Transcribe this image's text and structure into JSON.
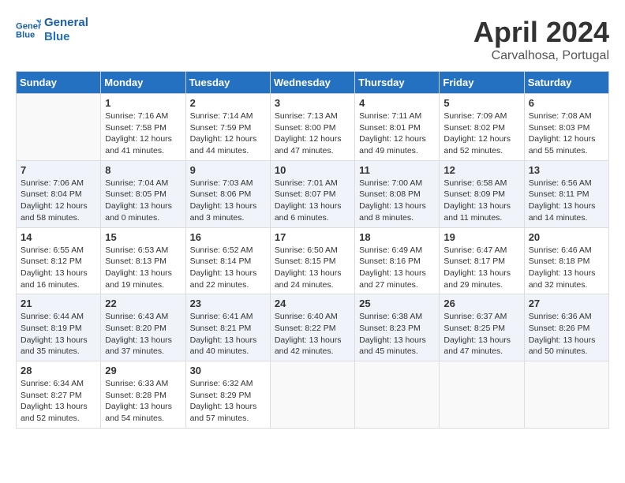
{
  "header": {
    "logo_line1": "General",
    "logo_line2": "Blue",
    "title": "April 2024",
    "subtitle": "Carvalhosa, Portugal"
  },
  "calendar": {
    "days_of_week": [
      "Sunday",
      "Monday",
      "Tuesday",
      "Wednesday",
      "Thursday",
      "Friday",
      "Saturday"
    ],
    "weeks": [
      [
        {
          "day": "",
          "info": ""
        },
        {
          "day": "1",
          "info": "Sunrise: 7:16 AM\nSunset: 7:58 PM\nDaylight: 12 hours\nand 41 minutes."
        },
        {
          "day": "2",
          "info": "Sunrise: 7:14 AM\nSunset: 7:59 PM\nDaylight: 12 hours\nand 44 minutes."
        },
        {
          "day": "3",
          "info": "Sunrise: 7:13 AM\nSunset: 8:00 PM\nDaylight: 12 hours\nand 47 minutes."
        },
        {
          "day": "4",
          "info": "Sunrise: 7:11 AM\nSunset: 8:01 PM\nDaylight: 12 hours\nand 49 minutes."
        },
        {
          "day": "5",
          "info": "Sunrise: 7:09 AM\nSunset: 8:02 PM\nDaylight: 12 hours\nand 52 minutes."
        },
        {
          "day": "6",
          "info": "Sunrise: 7:08 AM\nSunset: 8:03 PM\nDaylight: 12 hours\nand 55 minutes."
        }
      ],
      [
        {
          "day": "7",
          "info": "Sunrise: 7:06 AM\nSunset: 8:04 PM\nDaylight: 12 hours\nand 58 minutes."
        },
        {
          "day": "8",
          "info": "Sunrise: 7:04 AM\nSunset: 8:05 PM\nDaylight: 13 hours\nand 0 minutes."
        },
        {
          "day": "9",
          "info": "Sunrise: 7:03 AM\nSunset: 8:06 PM\nDaylight: 13 hours\nand 3 minutes."
        },
        {
          "day": "10",
          "info": "Sunrise: 7:01 AM\nSunset: 8:07 PM\nDaylight: 13 hours\nand 6 minutes."
        },
        {
          "day": "11",
          "info": "Sunrise: 7:00 AM\nSunset: 8:08 PM\nDaylight: 13 hours\nand 8 minutes."
        },
        {
          "day": "12",
          "info": "Sunrise: 6:58 AM\nSunset: 8:09 PM\nDaylight: 13 hours\nand 11 minutes."
        },
        {
          "day": "13",
          "info": "Sunrise: 6:56 AM\nSunset: 8:11 PM\nDaylight: 13 hours\nand 14 minutes."
        }
      ],
      [
        {
          "day": "14",
          "info": "Sunrise: 6:55 AM\nSunset: 8:12 PM\nDaylight: 13 hours\nand 16 minutes."
        },
        {
          "day": "15",
          "info": "Sunrise: 6:53 AM\nSunset: 8:13 PM\nDaylight: 13 hours\nand 19 minutes."
        },
        {
          "day": "16",
          "info": "Sunrise: 6:52 AM\nSunset: 8:14 PM\nDaylight: 13 hours\nand 22 minutes."
        },
        {
          "day": "17",
          "info": "Sunrise: 6:50 AM\nSunset: 8:15 PM\nDaylight: 13 hours\nand 24 minutes."
        },
        {
          "day": "18",
          "info": "Sunrise: 6:49 AM\nSunset: 8:16 PM\nDaylight: 13 hours\nand 27 minutes."
        },
        {
          "day": "19",
          "info": "Sunrise: 6:47 AM\nSunset: 8:17 PM\nDaylight: 13 hours\nand 29 minutes."
        },
        {
          "day": "20",
          "info": "Sunrise: 6:46 AM\nSunset: 8:18 PM\nDaylight: 13 hours\nand 32 minutes."
        }
      ],
      [
        {
          "day": "21",
          "info": "Sunrise: 6:44 AM\nSunset: 8:19 PM\nDaylight: 13 hours\nand 35 minutes."
        },
        {
          "day": "22",
          "info": "Sunrise: 6:43 AM\nSunset: 8:20 PM\nDaylight: 13 hours\nand 37 minutes."
        },
        {
          "day": "23",
          "info": "Sunrise: 6:41 AM\nSunset: 8:21 PM\nDaylight: 13 hours\nand 40 minutes."
        },
        {
          "day": "24",
          "info": "Sunrise: 6:40 AM\nSunset: 8:22 PM\nDaylight: 13 hours\nand 42 minutes."
        },
        {
          "day": "25",
          "info": "Sunrise: 6:38 AM\nSunset: 8:23 PM\nDaylight: 13 hours\nand 45 minutes."
        },
        {
          "day": "26",
          "info": "Sunrise: 6:37 AM\nSunset: 8:25 PM\nDaylight: 13 hours\nand 47 minutes."
        },
        {
          "day": "27",
          "info": "Sunrise: 6:36 AM\nSunset: 8:26 PM\nDaylight: 13 hours\nand 50 minutes."
        }
      ],
      [
        {
          "day": "28",
          "info": "Sunrise: 6:34 AM\nSunset: 8:27 PM\nDaylight: 13 hours\nand 52 minutes."
        },
        {
          "day": "29",
          "info": "Sunrise: 6:33 AM\nSunset: 8:28 PM\nDaylight: 13 hours\nand 54 minutes."
        },
        {
          "day": "30",
          "info": "Sunrise: 6:32 AM\nSunset: 8:29 PM\nDaylight: 13 hours\nand 57 minutes."
        },
        {
          "day": "",
          "info": ""
        },
        {
          "day": "",
          "info": ""
        },
        {
          "day": "",
          "info": ""
        },
        {
          "day": "",
          "info": ""
        }
      ]
    ]
  }
}
